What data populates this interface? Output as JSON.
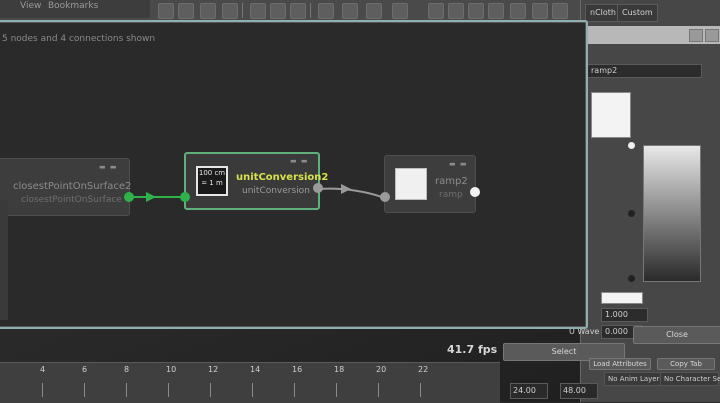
{
  "menu": {
    "items": [
      "View",
      "Bookmarks"
    ]
  },
  "editor": {
    "info": "5 nodes and 4 connections shown",
    "fps": "41.7 fps"
  },
  "nodes": {
    "closest": {
      "title": "closestPointOnSurface2",
      "subtitle": "closestPointOnSurface"
    },
    "unit": {
      "title": "unitConversion2",
      "subtitle": "unitConversion",
      "icon_top": "100 cm",
      "icon_bottom": "= 1 m"
    },
    "ramp": {
      "title": "ramp2",
      "subtitle": "ramp"
    }
  },
  "timeline": {
    "ticks": [
      "4",
      "6",
      "8",
      "10",
      "12",
      "14",
      "16",
      "18",
      "20",
      "22"
    ],
    "range_start": "24.00",
    "range_end": "48.00",
    "anim_layer": "No Anim Layer",
    "character_set": "No Character Set"
  },
  "attr": {
    "tabs": [
      "nCloth",
      "Custom"
    ],
    "name_field": "ramp2",
    "field_value_1": "1.000",
    "uwave_label": "U Wave",
    "uwave_value": "0.000",
    "select_button": "Select",
    "close_button": "Close",
    "load_attributes": "Load Attributes",
    "copy_tab": "Copy Tab"
  },
  "colors": {
    "selected_border": "#5fb07a",
    "selected_title": "#d8e24a",
    "connection_green": "#2fb24a"
  }
}
